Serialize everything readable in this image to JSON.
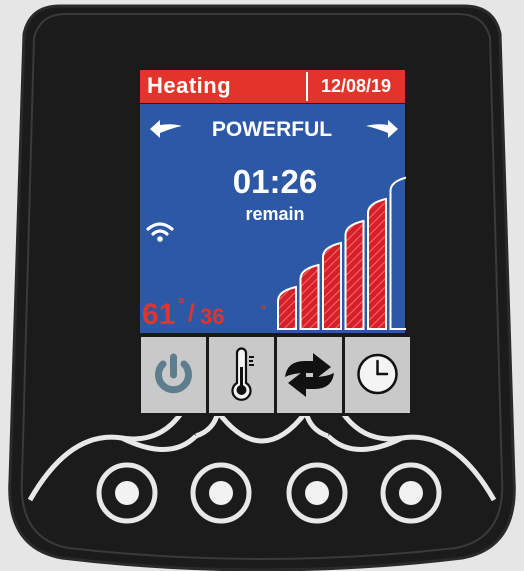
{
  "display": {
    "mode": "Heating",
    "date": "12/08/19",
    "power_mode": "POWERFUL",
    "timer": {
      "time": "01:26",
      "caption": "remain"
    },
    "temperature": {
      "actual": "61",
      "target": "36",
      "degree_symbol": "°",
      "separator": "/"
    },
    "power_level": {
      "active_bars": 5,
      "total_bars": 6
    },
    "wifi_icon": "wifi-icon"
  },
  "soft_buttons": [
    {
      "name": "power-button",
      "icon": "power-icon"
    },
    {
      "name": "temperature-button",
      "icon": "thermometer-icon"
    },
    {
      "name": "mode-button",
      "icon": "cycle-arrows-icon"
    },
    {
      "name": "timer-button",
      "icon": "clock-icon"
    }
  ],
  "colors": {
    "header_red": "#e3342b",
    "screen_blue": "#2c58a6",
    "button_gray": "#c9c9c9",
    "bezel": "#1b1b1b",
    "power_icon": "#5e7d8d"
  }
}
